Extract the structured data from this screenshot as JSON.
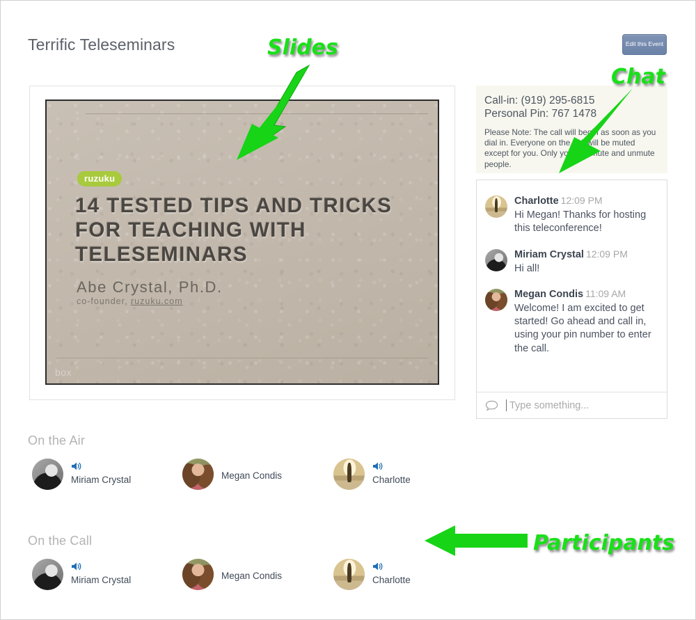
{
  "header": {
    "title": "Terrific Teleseminars",
    "edit_button_label": "Edit this Event"
  },
  "slide": {
    "logo": "ruzuku",
    "title": "14 TESTED TIPS AND TRICKS FOR TEACHING WITH TELESEMINARS",
    "author": "Abe Crystal, Ph.D.",
    "subauthor_prefix": "co-founder, ",
    "subauthor_link": "ruzuku.com",
    "footer_mark": "box"
  },
  "callin": {
    "call_in_line": "Call-in: (919) 295-6815",
    "pin_line": "Personal Pin: 767 1478",
    "note": "Please Note: The call will begin as soon as you dial in. Everyone on the call will be muted except for you. Only you can mute and unmute people."
  },
  "chat": {
    "messages": [
      {
        "author": "Charlotte",
        "time": "12:09 PM",
        "text": "Hi Megan! Thanks for hosting this teleconference!",
        "avatar": "charlotte-avatar"
      },
      {
        "author": "Miriam Crystal",
        "time": "12:09 PM",
        "text": "Hi all!",
        "avatar": "miriam-avatar"
      },
      {
        "author": "Megan Condis",
        "time": "11:09 AM",
        "text": "Welcome! I am excited to get started! Go ahead and call in, using your pin number to enter the call.",
        "avatar": "megan-avatar"
      }
    ],
    "input_value": "",
    "input_placeholder": "Type something...",
    "input_icon": "speech-bubble-icon"
  },
  "on_the_air": {
    "title": "On the Air",
    "people": [
      {
        "name": "Miriam Crystal",
        "avatar": "miriam-avatar",
        "speaker_icon": true
      },
      {
        "name": "Megan Condis",
        "avatar": "megan-avatar",
        "speaker_icon": false
      },
      {
        "name": "Charlotte",
        "avatar": "charlotte-avatar",
        "speaker_icon": true
      }
    ]
  },
  "on_the_call": {
    "title": "On the Call",
    "people": [
      {
        "name": "Miriam Crystal",
        "avatar": "miriam-avatar",
        "speaker_icon": true
      },
      {
        "name": "Megan Condis",
        "avatar": "megan-avatar",
        "speaker_icon": false
      },
      {
        "name": "Charlotte",
        "avatar": "charlotte-avatar",
        "speaker_icon": true
      }
    ]
  },
  "annotations": {
    "slides_label": "Slides",
    "chat_label": "Chat",
    "participants_label": "Participants"
  },
  "colors": {
    "annotation_green": "#19e019",
    "speaker_icon_blue": "#1f6fb5",
    "button_blue": "#7287ac",
    "callin_background": "#f7f7ef"
  }
}
